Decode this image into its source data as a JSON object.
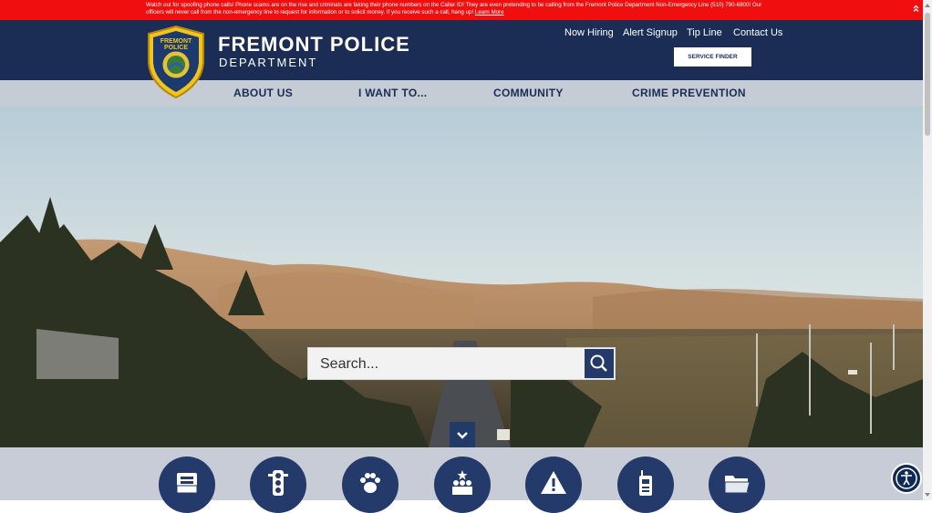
{
  "alert": {
    "text": "Watch out for spoofing phone calls! Phone scams are on the rise and criminals are faking their phone numbers on the Caller ID! They are even pretending to be calling from the Fremont Police Department Non-Emergency Line (510) 790-6800! Our officers will never call from the non-emergency line to request for information or to solicit money.  If you receive such a call, hang up!",
    "link": "Learn More",
    "collapse_icon": "double-chevron-up-icon"
  },
  "brand": {
    "title": "FREMONT POLICE",
    "subtitle": "DEPARTMENT",
    "badge_top_text": "FREMONT",
    "badge_second_text": "POLICE"
  },
  "utility_nav": {
    "links": [
      "Now Hiring",
      "Alert Signup",
      "Tip Line",
      "Contact Us"
    ],
    "service_finder": "SERVICE FINDER"
  },
  "main_nav": {
    "items": [
      "ABOUT US",
      "I WANT TO...",
      "COMMUNITY",
      "CRIME PREVENTION"
    ]
  },
  "search": {
    "placeholder": "Search..."
  },
  "quick_links": {
    "icons": [
      "documents-icon",
      "traffic-light-icon",
      "paw-icon",
      "community-icon",
      "warning-icon",
      "radio-icon",
      "open-folder-icon"
    ]
  },
  "colors": {
    "alert": "#f10e0e",
    "header": "#1b2c55",
    "nav": "#c6ccd5",
    "accent": "#233a6b"
  }
}
